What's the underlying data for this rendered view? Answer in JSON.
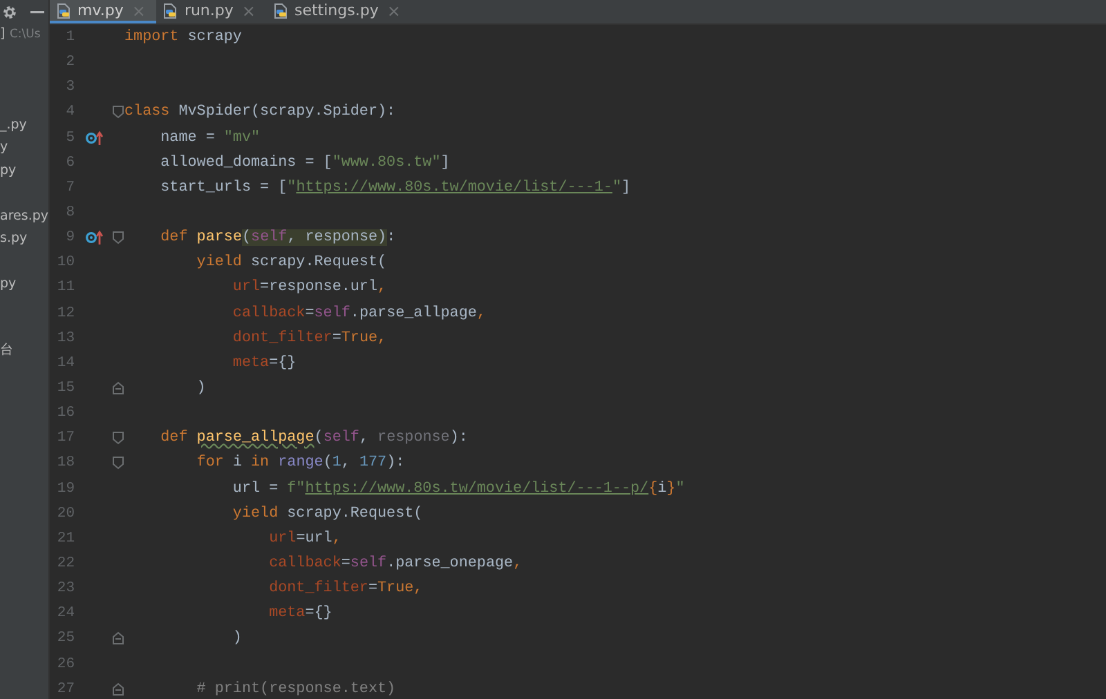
{
  "sidebar": {
    "items": [
      {
        "text": "]",
        "kind": "bracket"
      },
      {
        "text": "C:\\Us",
        "kind": "path"
      },
      {
        "text": "_.py",
        "kind": "file"
      },
      {
        "text": "y",
        "kind": "file"
      },
      {
        "text": "py",
        "kind": "file"
      },
      {
        "text": "ares.py",
        "kind": "file"
      },
      {
        "text": "s.py",
        "kind": "file"
      },
      {
        "text": "py",
        "kind": "file"
      },
      {
        "text": "台",
        "kind": "file"
      }
    ]
  },
  "tabs": [
    {
      "label": "mv.py",
      "selected": true,
      "close": "×"
    },
    {
      "label": "run.py",
      "selected": false,
      "close": "×"
    },
    {
      "label": "settings.py",
      "selected": false,
      "close": "×"
    }
  ],
  "editor": {
    "lines": [
      {
        "number": "1",
        "tokens": [
          {
            "text": "import ",
            "kind": "kw"
          },
          {
            "text": "scrapy",
            "kind": "plain"
          }
        ]
      },
      {
        "number": "2"
      },
      {
        "number": "3"
      },
      {
        "number": "4",
        "fold_start": true,
        "tokens": [
          {
            "text": "class ",
            "kind": "kw"
          },
          {
            "text": "MvSpider(scrapy.Spider):",
            "kind": "plain"
          }
        ]
      },
      {
        "number": "5",
        "marker": true,
        "tokens": [
          {
            "text": "    name = ",
            "kind": "plain"
          },
          {
            "text": "\"mv\"",
            "kind": "str"
          }
        ]
      },
      {
        "number": "6",
        "tokens": [
          {
            "text": "    allowed_domains = [",
            "kind": "plain"
          },
          {
            "text": "\"www.80s.tw\"",
            "kind": "str"
          },
          {
            "text": "]",
            "kind": "plain"
          }
        ]
      },
      {
        "number": "7",
        "tokens": [
          {
            "text": "    start_urls = [",
            "kind": "plain"
          },
          {
            "text": "\"",
            "kind": "str"
          },
          {
            "text": "https://www.80s.tw/movie/list/---1-",
            "kind": "link"
          },
          {
            "text": "\"",
            "kind": "str"
          },
          {
            "text": "]",
            "kind": "plain"
          }
        ]
      },
      {
        "number": "8"
      },
      {
        "number": "9",
        "marker": true,
        "fold_start": true,
        "tokens": [
          {
            "text": "    def ",
            "kind": "kw"
          },
          {
            "text": "parse",
            "kind": "fn"
          },
          {
            "text": "(",
            "kind": "hl"
          },
          {
            "text": "self",
            "kind": "hlself"
          },
          {
            "text": ", response)",
            "kind": "hl"
          },
          {
            "text": ":",
            "kind": "plain"
          }
        ]
      },
      {
        "number": "10",
        "tokens": [
          {
            "text": "        yield ",
            "kind": "kw"
          },
          {
            "text": "scrapy.Request(",
            "kind": "plain"
          }
        ]
      },
      {
        "number": "11",
        "tokens": [
          {
            "text": "            url",
            "kind": "param"
          },
          {
            "text": "=response.url",
            "kind": "plain"
          },
          {
            "text": ",",
            "kind": "kw"
          }
        ]
      },
      {
        "number": "12",
        "tokens": [
          {
            "text": "            callback",
            "kind": "param"
          },
          {
            "text": "=",
            "kind": "plain"
          },
          {
            "text": "self",
            "kind": "self"
          },
          {
            "text": ".parse_allpage",
            "kind": "plain"
          },
          {
            "text": ",",
            "kind": "kw"
          }
        ]
      },
      {
        "number": "13",
        "tokens": [
          {
            "text": "            dont_filter",
            "kind": "param"
          },
          {
            "text": "=",
            "kind": "plain"
          },
          {
            "text": "True",
            "kind": "kw"
          },
          {
            "text": ",",
            "kind": "kw"
          }
        ]
      },
      {
        "number": "14",
        "tokens": [
          {
            "text": "            meta",
            "kind": "param"
          },
          {
            "text": "={}",
            "kind": "plain"
          }
        ]
      },
      {
        "number": "15",
        "fold_end": true,
        "tokens": [
          {
            "text": "        )",
            "kind": "plain"
          }
        ]
      },
      {
        "number": "16"
      },
      {
        "number": "17",
        "fold_start": true,
        "tokens": [
          {
            "text": "    def ",
            "kind": "kw"
          },
          {
            "text": "parse_allpage",
            "kind": "fnwavy"
          },
          {
            "text": "(",
            "kind": "plain"
          },
          {
            "text": "self",
            "kind": "self"
          },
          {
            "text": ", ",
            "kind": "plain"
          },
          {
            "text": "response",
            "kind": "unused"
          },
          {
            "text": "):",
            "kind": "plain"
          }
        ]
      },
      {
        "number": "18",
        "fold_start": true,
        "tokens": [
          {
            "text": "        for ",
            "kind": "kw"
          },
          {
            "text": "i ",
            "kind": "plain"
          },
          {
            "text": "in ",
            "kind": "kw"
          },
          {
            "text": "range",
            "kind": "builtin"
          },
          {
            "text": "(",
            "kind": "plain"
          },
          {
            "text": "1",
            "kind": "num"
          },
          {
            "text": ", ",
            "kind": "plain"
          },
          {
            "text": "177",
            "kind": "num"
          },
          {
            "text": "):",
            "kind": "plain"
          }
        ]
      },
      {
        "number": "19",
        "tokens": [
          {
            "text": "            url = ",
            "kind": "plain"
          },
          {
            "text": "f\"",
            "kind": "str"
          },
          {
            "text": "https://www.80s.tw/movie/list/---1--p/",
            "kind": "link"
          },
          {
            "text": "{",
            "kind": "kw"
          },
          {
            "text": "i",
            "kind": "plain"
          },
          {
            "text": "}",
            "kind": "kw"
          },
          {
            "text": "\"",
            "kind": "str"
          }
        ]
      },
      {
        "number": "20",
        "tokens": [
          {
            "text": "            yield ",
            "kind": "kw"
          },
          {
            "text": "scrapy.Request(",
            "kind": "plain"
          }
        ]
      },
      {
        "number": "21",
        "tokens": [
          {
            "text": "                url",
            "kind": "param"
          },
          {
            "text": "=url",
            "kind": "plain"
          },
          {
            "text": ",",
            "kind": "kw"
          }
        ]
      },
      {
        "number": "22",
        "tokens": [
          {
            "text": "                callback",
            "kind": "param"
          },
          {
            "text": "=",
            "kind": "plain"
          },
          {
            "text": "self",
            "kind": "self"
          },
          {
            "text": ".parse_onepage",
            "kind": "plain"
          },
          {
            "text": ",",
            "kind": "kw"
          }
        ]
      },
      {
        "number": "23",
        "tokens": [
          {
            "text": "                dont_filter",
            "kind": "param"
          },
          {
            "text": "=",
            "kind": "plain"
          },
          {
            "text": "True",
            "kind": "kw"
          },
          {
            "text": ",",
            "kind": "kw"
          }
        ]
      },
      {
        "number": "24",
        "tokens": [
          {
            "text": "                meta",
            "kind": "param"
          },
          {
            "text": "={}",
            "kind": "plain"
          }
        ]
      },
      {
        "number": "25",
        "fold_end": true,
        "tokens": [
          {
            "text": "            )",
            "kind": "plain"
          }
        ]
      },
      {
        "number": "26"
      },
      {
        "number": "27",
        "fold_end": true,
        "tokens": [
          {
            "text": "        # print(response.text)",
            "kind": "comment"
          }
        ]
      }
    ]
  }
}
